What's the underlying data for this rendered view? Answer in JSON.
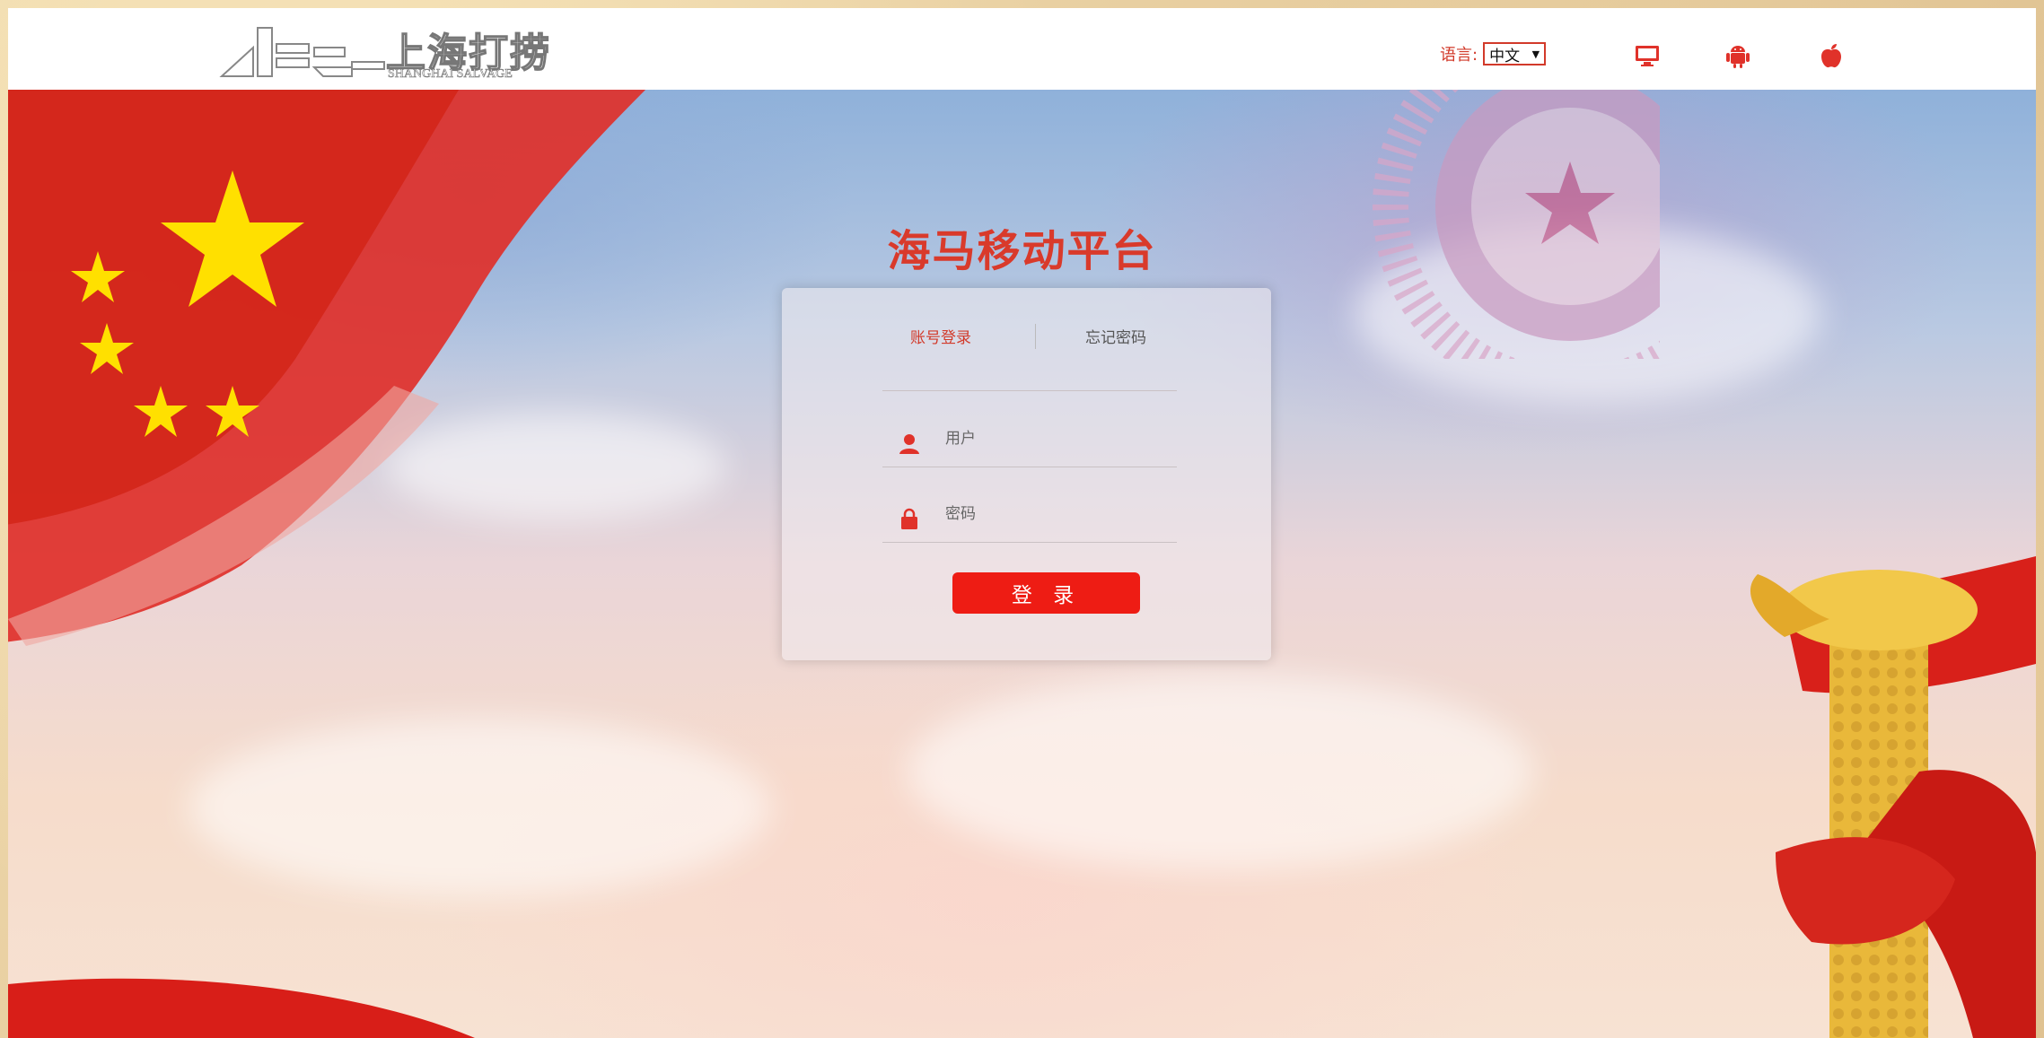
{
  "header": {
    "logo_cn": "上海打捞",
    "logo_en": "SHANGHAI SALVAGE",
    "language_label": "语言:",
    "language_value": "中文",
    "icons": [
      "desktop-icon",
      "android-icon",
      "apple-icon"
    ]
  },
  "main": {
    "title": "海马移动平台",
    "tabs": [
      {
        "label": "账号登录",
        "active": true
      },
      {
        "label": "忘记密码",
        "active": false
      }
    ],
    "username_placeholder": "用户",
    "password_placeholder": "密码",
    "login_label": "登 录"
  },
  "colors": {
    "accent": "#d23a2a",
    "button": "#ee1c14"
  }
}
